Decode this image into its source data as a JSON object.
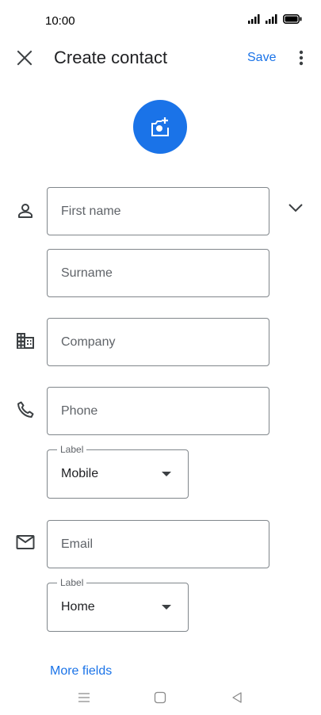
{
  "status_bar": {
    "time": "10:00",
    "icons": [
      "signal-icon",
      "signal-icon",
      "battery-icon"
    ]
  },
  "app_bar": {
    "title": "Create contact",
    "save_label": "Save",
    "close_icon": "close-icon",
    "more_icon": "more-vert-icon"
  },
  "photo": {
    "icon": "add-photo-icon",
    "color": "#1a73e8"
  },
  "form": {
    "first_name": {
      "placeholder": "First name",
      "value": ""
    },
    "surname": {
      "placeholder": "Surname",
      "value": ""
    },
    "company": {
      "placeholder": "Company",
      "value": ""
    },
    "phone": {
      "placeholder": "Phone",
      "value": ""
    },
    "phone_label": {
      "legend": "Label",
      "value": "Mobile"
    },
    "email": {
      "placeholder": "Email",
      "value": ""
    },
    "email_label": {
      "legend": "Label",
      "value": "Home"
    },
    "more_fields": "More fields"
  },
  "colors": {
    "accent": "#1a73e8",
    "outline": "#80868b",
    "icon": "#5f6368"
  }
}
